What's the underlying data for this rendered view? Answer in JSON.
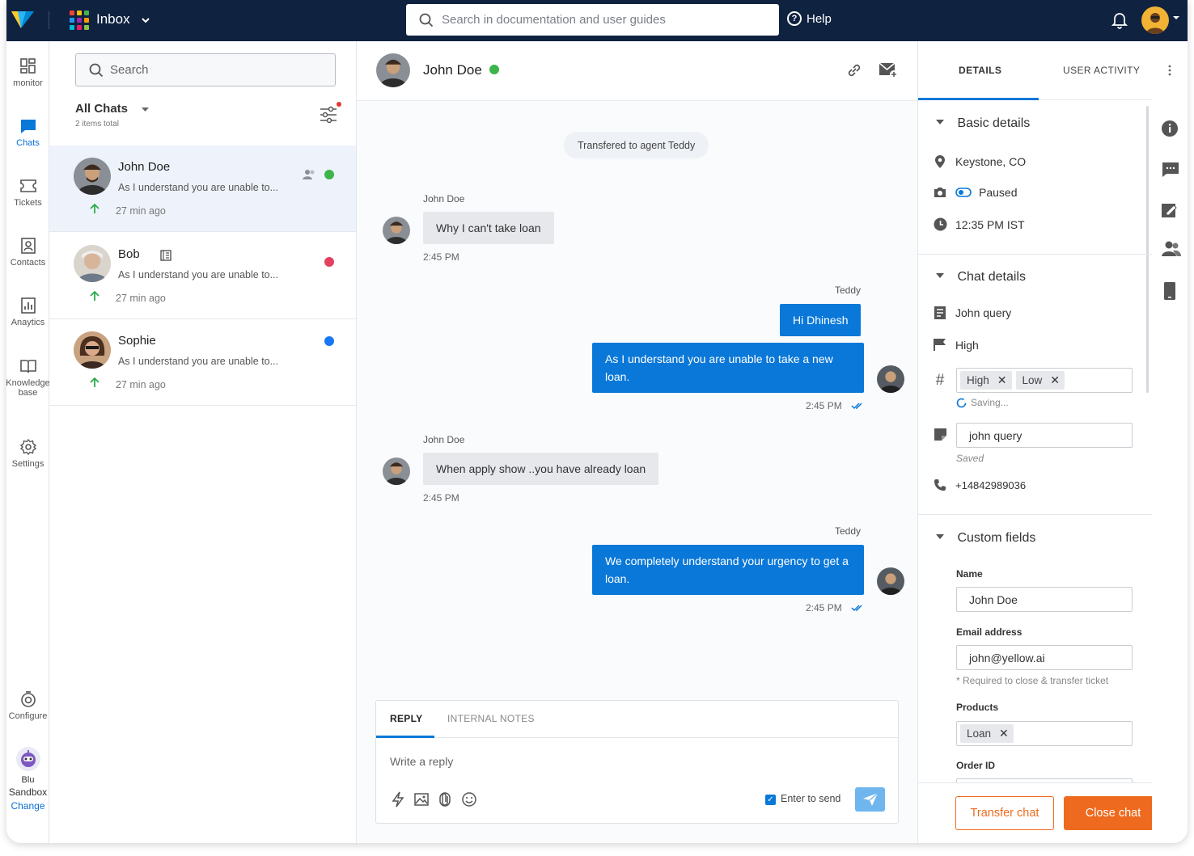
{
  "topbar": {
    "app_title": "Inbox",
    "search_placeholder": "Search in documentation and user guides",
    "help_label": "Help"
  },
  "nav": {
    "items": [
      {
        "label": "monitor"
      },
      {
        "label": "Chats"
      },
      {
        "label": "Tickets"
      },
      {
        "label": "Contacts"
      },
      {
        "label": "Anaytics"
      },
      {
        "label": "Knowledge"
      },
      {
        "label": "base"
      },
      {
        "label": "Settings"
      },
      {
        "label": "Configure"
      }
    ],
    "bot_name": "Blu",
    "bot_env": "Sandbox",
    "change_label": "Change"
  },
  "chatlist": {
    "search_placeholder": "Search",
    "filter_title": "All Chats",
    "count": "2 items total",
    "rows": [
      {
        "name": "John Doe",
        "preview": "As I understand you are unable to...",
        "time": "27 min ago",
        "channel_color": "#3cb54a"
      },
      {
        "name": "Bob",
        "preview": "As I understand you are unable to...",
        "time": "27 min ago",
        "channel_color": "#e4405f"
      },
      {
        "name": "Sophie",
        "preview": "As I understand you are unable to...",
        "time": "27 min ago",
        "channel_color": "#1877f2"
      }
    ]
  },
  "conversation": {
    "contact_name": "John Doe",
    "system_message": "Transfered to agent Teddy",
    "messages": [
      {
        "author": "John Doe",
        "text": "Why I can't take loan",
        "time": "2:45 PM"
      },
      {
        "author": "Teddy",
        "text": "Hi Dhinesh"
      },
      {
        "text": "As I understand you are unable to take a new loan.",
        "time": "2:45 PM"
      },
      {
        "author": "John Doe",
        "text": "When apply show ..you have already loan",
        "time": "2:45 PM"
      },
      {
        "author": "Teddy",
        "text": "We completely understand your urgency to get a loan.",
        "time": "2:45 PM"
      }
    ],
    "composer": {
      "tab_reply": "REPLY",
      "tab_notes": "INTERNAL NOTES",
      "placeholder": "Write a reply",
      "enter_to_send": "Enter to send"
    }
  },
  "details": {
    "tab_details": "DETAILS",
    "tab_activity": "USER ACTIVITY",
    "basic": {
      "title": "Basic details",
      "location": "Keystone, CO",
      "status": "Paused",
      "time": "12:35 PM IST"
    },
    "chat": {
      "title": "Chat details",
      "subject": "John query",
      "priority": "High",
      "tags": [
        "High",
        "Low"
      ],
      "saving": "Saving...",
      "note": "john query",
      "saved": "Saved",
      "phone": "+14842989036"
    },
    "custom": {
      "title": "Custom fields",
      "name_label": "Name",
      "name_value": "John Doe",
      "email_label": "Email address",
      "email_value": "john@yellow.ai",
      "email_hint": "* Required to close & transfer ticket",
      "products_label": "Products",
      "products": [
        "Loan"
      ],
      "order_label": "Order ID"
    },
    "transfer_label": "Transfer chat",
    "close_label": "Close chat"
  },
  "colors": {
    "topbar": "#0f2240",
    "accent": "#0a78d8",
    "action": "#ee6a1f"
  }
}
